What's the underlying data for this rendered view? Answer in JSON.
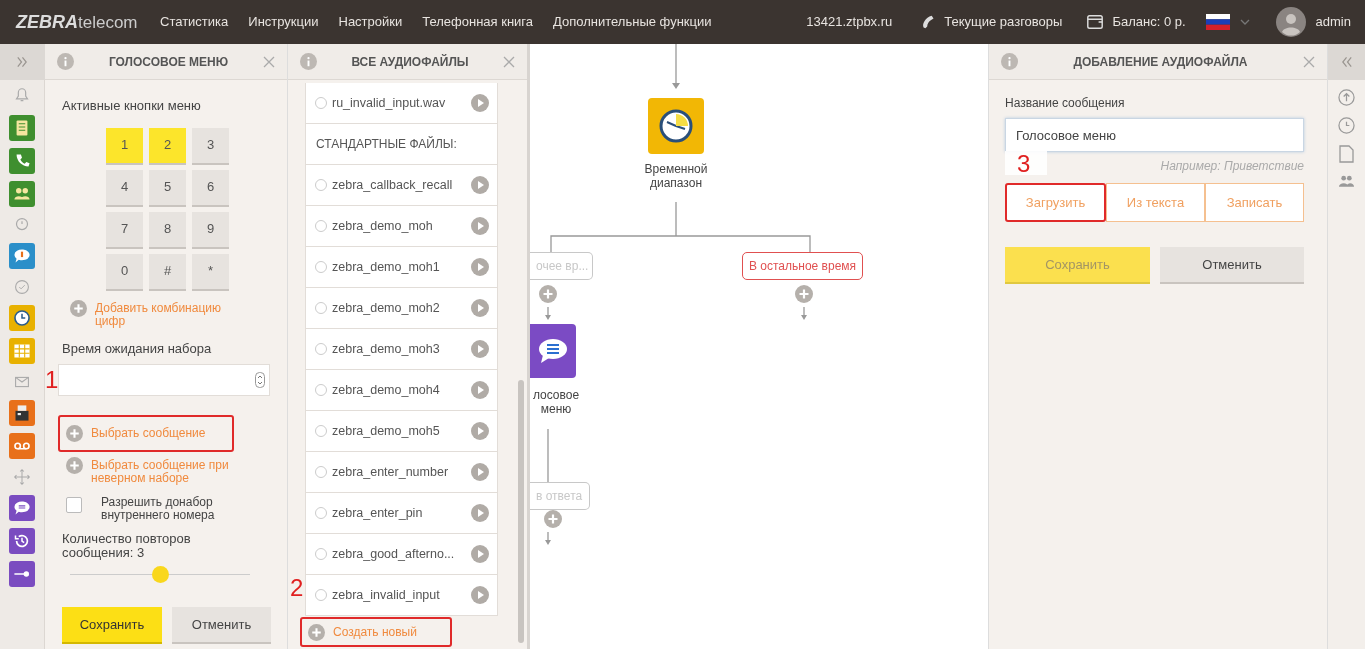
{
  "topbar": {
    "logo_bold": "ZEBRA",
    "logo_light": "telecom",
    "nav": [
      "Статистика",
      "Инструкции",
      "Настройки",
      "Телефонная книга",
      "Дополнительные функции"
    ],
    "domain": "13421.ztpbx.ru",
    "calls": "Текущие разговоры",
    "balance": "Баланс: 0 р.",
    "user": "admin"
  },
  "sidebar": {
    "items": [
      {
        "kind": "outline"
      },
      {
        "kind": "tile",
        "color": "#3f8f2f"
      },
      {
        "kind": "tile",
        "color": "#3f8f2f"
      },
      {
        "kind": "tile",
        "color": "#3f8f2f"
      },
      {
        "kind": "outline"
      },
      {
        "kind": "tile",
        "color": "#2b8fc9"
      },
      {
        "kind": "outline"
      },
      {
        "kind": "tile",
        "color": "#e8b100"
      },
      {
        "kind": "tile",
        "color": "#e8b100"
      },
      {
        "kind": "outline"
      },
      {
        "kind": "tile",
        "color": "#e8701a"
      },
      {
        "kind": "tile",
        "color": "#e8701a"
      },
      {
        "kind": "outline"
      },
      {
        "kind": "tile",
        "color": "#7a4cc0"
      },
      {
        "kind": "tile",
        "color": "#7a4cc0"
      },
      {
        "kind": "tile",
        "color": "#7a4cc0"
      }
    ]
  },
  "voice_menu": {
    "title": "ГОЛОСОВОЕ МЕНЮ",
    "keys_label": "Активные кнопки меню",
    "keys": [
      {
        "label": "1",
        "selected": true
      },
      {
        "label": "2",
        "selected": true
      },
      {
        "label": "3",
        "selected": false
      },
      {
        "label": "4",
        "selected": false
      },
      {
        "label": "5",
        "selected": false
      },
      {
        "label": "6",
        "selected": false
      },
      {
        "label": "7",
        "selected": false
      },
      {
        "label": "8",
        "selected": false
      },
      {
        "label": "9",
        "selected": false
      },
      {
        "label": "0",
        "selected": false
      },
      {
        "label": "#",
        "selected": false
      },
      {
        "label": "*",
        "selected": false
      }
    ],
    "add_combo": {
      "text": "Добавить комбинацию цифр",
      "highlighted": false
    },
    "wait_label": "Время ожидания набора",
    "message_links": [
      {
        "text": "Выбрать сообщение",
        "highlighted": true
      },
      {
        "text": "Выбрать сообщение при неверном наборе",
        "highlighted": false
      }
    ],
    "allow_extension": {
      "label": "Разрешить донабор внутреннего номера",
      "checked": false
    },
    "repeat_label": "Количество повторов сообщения: 3",
    "repeat_slider": {
      "level": 0.5
    },
    "save": {
      "label": "Сохранить",
      "disabled": false
    },
    "cancel": "Отменить"
  },
  "audio_files": {
    "title": "ВСЕ АУДИОФАЙЛЫ",
    "items": [
      {
        "kind": "file",
        "name": "ru_invalid_input.wav",
        "selected": false
      },
      {
        "kind": "header",
        "name": "СТАНДАРТНЫЕ ФАЙЛЫ:"
      },
      {
        "kind": "file",
        "name": "zebra_callback_recall",
        "selected": false
      },
      {
        "kind": "file",
        "name": "zebra_demo_moh",
        "selected": false
      },
      {
        "kind": "file",
        "name": "zebra_demo_moh1",
        "selected": false
      },
      {
        "kind": "file",
        "name": "zebra_demo_moh2",
        "selected": false
      },
      {
        "kind": "file",
        "name": "zebra_demo_moh3",
        "selected": false
      },
      {
        "kind": "file",
        "name": "zebra_demo_moh4",
        "selected": false
      },
      {
        "kind": "file",
        "name": "zebra_demo_moh5",
        "selected": false
      },
      {
        "kind": "file",
        "name": "zebra_enter_number",
        "selected": false
      },
      {
        "kind": "file",
        "name": "zebra_enter_pin",
        "selected": false
      },
      {
        "kind": "file",
        "name": "zebra_good_afterno...",
        "selected": false
      },
      {
        "kind": "file",
        "name": "zebra_invalid_input",
        "selected": false
      }
    ],
    "create": {
      "text": "Создать новый",
      "highlighted": true
    }
  },
  "canvas": {
    "time_node": {
      "label": "Временной диапазон"
    },
    "branches": [
      {
        "label": "очее вр...",
        "color": "#c8c8c8"
      },
      {
        "label": "В остальное время",
        "color": "#e05050"
      },
      {
        "label": "в ответа",
        "color": "#c8c8c8"
      }
    ],
    "voice_node": {
      "label": "лосовое меню"
    }
  },
  "add_audio": {
    "title": "ДОБАВЛЕНИЕ АУДИОФАЙЛА",
    "name_label": "Название сообщения",
    "name_value": "Голосовое меню",
    "hint": "Например: Приветствие",
    "source_buttons": [
      {
        "label": "Загрузить",
        "highlighted": true
      },
      {
        "label": "Из текста",
        "highlighted": false
      },
      {
        "label": "Записать",
        "highlighted": false
      }
    ],
    "save": {
      "label": "Сохранить",
      "disabled": true
    },
    "cancel": "Отменить"
  },
  "annotations": [
    {
      "number": "1"
    },
    {
      "number": "2"
    },
    {
      "number": "3"
    }
  ]
}
